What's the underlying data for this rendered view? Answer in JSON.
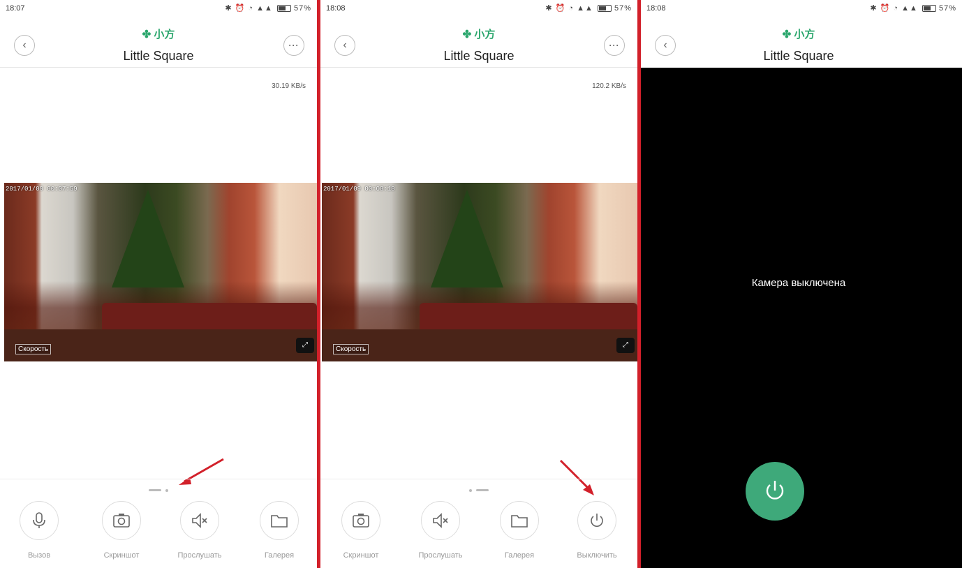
{
  "screens": [
    {
      "status_time": "18:07",
      "status_battery": "57%",
      "brand": "小方",
      "title": "Little Square",
      "speed": "30.19 KB/s",
      "timestamp": "2017/01/09 00:07:59",
      "video_label": "Скорость",
      "controls": [
        {
          "label": "Вызов",
          "icon": "microphone-icon"
        },
        {
          "label": "Скриншот",
          "icon": "camera-icon"
        },
        {
          "label": "Прослушать",
          "icon": "speaker-mute-icon"
        },
        {
          "label": "Галерея",
          "icon": "folder-icon"
        }
      ]
    },
    {
      "status_time": "18:08",
      "status_battery": "57%",
      "brand": "小方",
      "title": "Little Square",
      "speed": "120.2 KB/s",
      "timestamp": "2017/01/09 00:08:18",
      "video_label": "Скорость",
      "controls": [
        {
          "label": "Скриншот",
          "icon": "camera-icon"
        },
        {
          "label": "Прослушать",
          "icon": "speaker-mute-icon"
        },
        {
          "label": "Галерея",
          "icon": "folder-icon"
        },
        {
          "label": "Выключить",
          "icon": "power-icon"
        }
      ]
    },
    {
      "status_time": "18:08",
      "status_battery": "57%",
      "brand": "小方",
      "title": "Little Square",
      "camera_off_text": "Камера выключена",
      "power_icon": "power-icon"
    }
  ],
  "colors": {
    "accent": "#3ea97a",
    "brand": "#2aa66c",
    "annotation_arrow": "#d2202a",
    "divider": "#d2202a"
  }
}
